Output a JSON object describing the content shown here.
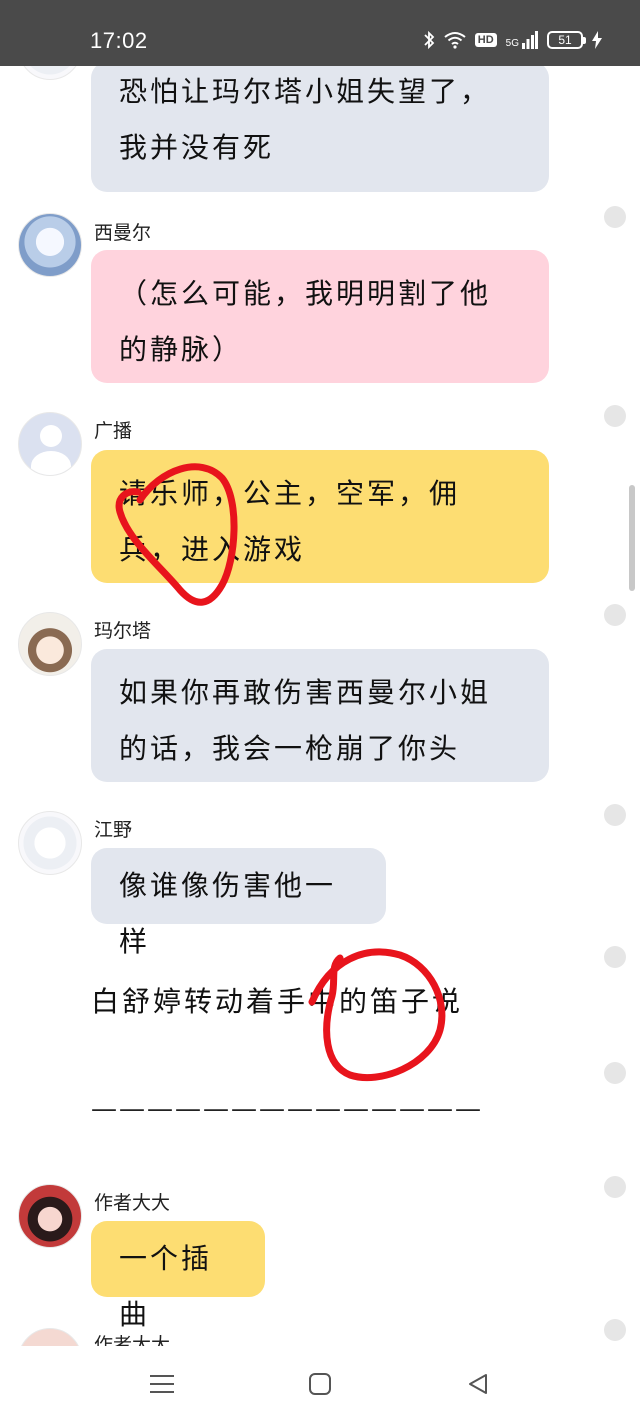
{
  "status_bar": {
    "time": "17:02",
    "network": "5G",
    "hd": "HD",
    "battery": "51"
  },
  "messages": [
    {
      "type": "message",
      "name": "",
      "text": "恐怕让玛尔塔小姐失望了，我并没有死",
      "bubble": "gray"
    },
    {
      "type": "message",
      "name": "西曼尔",
      "text": "（怎么可能，我明明割了他的静脉）",
      "bubble": "pink"
    },
    {
      "type": "message",
      "name": "广播",
      "text": "请乐师，公主，空军，佣兵，进入游戏",
      "bubble": "yellow"
    },
    {
      "type": "message",
      "name": "玛尔塔",
      "text": "如果你再敢伤害西曼尔小姐的话，我会一枪崩了你头",
      "bubble": "gray"
    },
    {
      "type": "message",
      "name": "江野",
      "text": "像谁像伤害他一样",
      "bubble": "gray"
    },
    {
      "type": "narration",
      "text": "白舒婷转动着手中的笛子说"
    },
    {
      "type": "divider",
      "text": "——————————————"
    },
    {
      "type": "message",
      "name": "作者大大",
      "text": "一个插曲",
      "bubble": "yellow"
    },
    {
      "type": "message",
      "name": "作者大大",
      "text": "",
      "bubble": ""
    }
  ],
  "colors": {
    "bubble_gray": "#e2e6ee",
    "bubble_pink": "#ffd3dd",
    "bubble_yellow": "#fddd72",
    "annotation_red": "#e8141c"
  },
  "nav": {
    "menu_icon": "menu-icon",
    "home_icon": "home-square-icon",
    "back_icon": "back-triangle-icon"
  }
}
